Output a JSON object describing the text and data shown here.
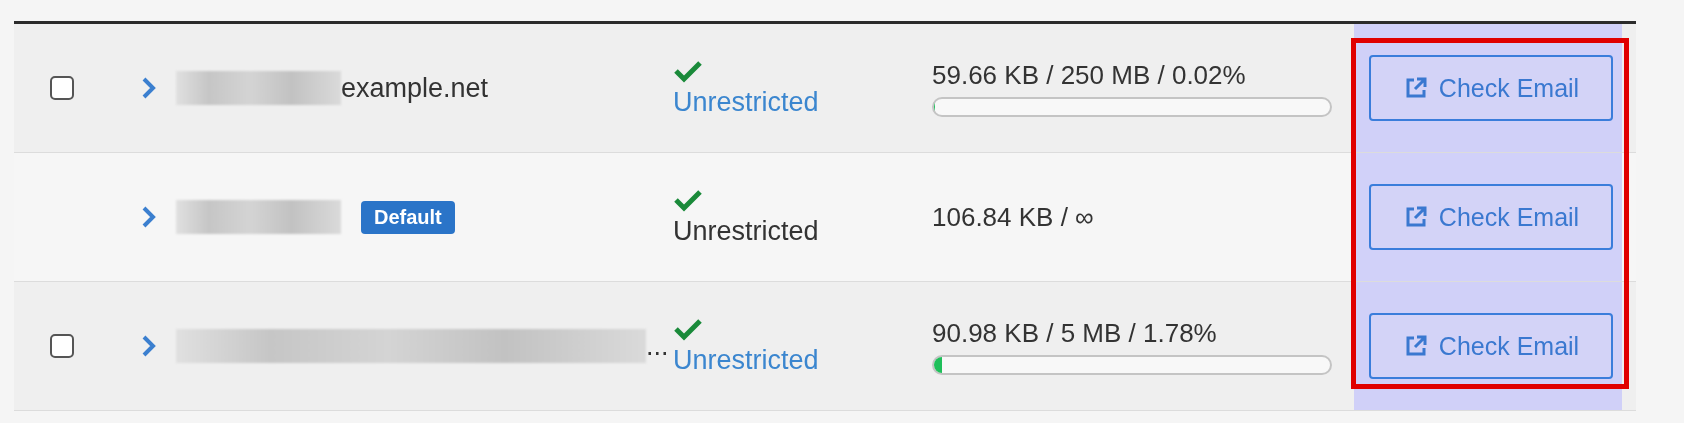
{
  "actions_column": {
    "highlighted": true
  },
  "rows": [
    {
      "selectable": true,
      "checked": false,
      "redacted": true,
      "name": "example.net",
      "default_badge": null,
      "status": "Unrestricted",
      "status_link": true,
      "usage": "59.66 KB / 250 MB / 0.02%",
      "has_quota": true,
      "level": 0.0002,
      "action": "Check Email"
    },
    {
      "selectable": false,
      "redacted": true,
      "name": null,
      "default_badge": "Default",
      "status": "Unrestricted",
      "status_link": false,
      "usage": "106.84 KB / ∞",
      "has_quota": false,
      "action": "Check Email"
    },
    {
      "selectable": true,
      "checked": false,
      "redacted": true,
      "name": "...",
      "default_badge": null,
      "status": "Unrestricted",
      "status_link": true,
      "usage": "90.98 KB / 5 MB / 1.78%",
      "has_quota": true,
      "level": 0.0178,
      "action": "Check Email"
    }
  ]
}
